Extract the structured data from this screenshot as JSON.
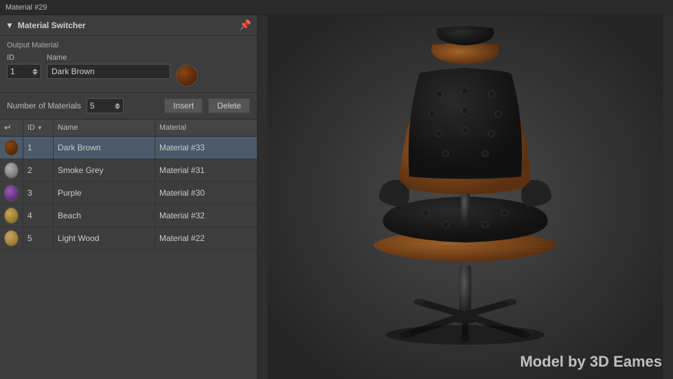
{
  "titleBar": {
    "label": "Material #29"
  },
  "panel": {
    "title": "Material Switcher",
    "pinIcon": "pin"
  },
  "outputSection": {
    "label": "Output Material",
    "idLabel": "ID",
    "idValue": "1",
    "nameLabel": "Name",
    "nameValue": "Dark Brown"
  },
  "countSection": {
    "label": "Number of Materials",
    "countValue": "5",
    "insertLabel": "Insert",
    "deleteLabel": "Delete"
  },
  "tableHeaders": {
    "swatchCol": "",
    "idCol": "ID",
    "nameCol": "Name",
    "materialCol": "Material"
  },
  "tableRows": [
    {
      "id": 1,
      "name": "Dark Brown",
      "material": "Material #33",
      "swatchClass": "swatch-darkbrown",
      "selected": true
    },
    {
      "id": 2,
      "name": "Smoke Grey",
      "material": "Material #31",
      "swatchClass": "swatch-smokegrey",
      "selected": false
    },
    {
      "id": 3,
      "name": "Purple",
      "material": "Material #30",
      "swatchClass": "swatch-purple",
      "selected": false
    },
    {
      "id": 4,
      "name": "Beach",
      "material": "Material #32",
      "swatchClass": "swatch-beach",
      "selected": false
    },
    {
      "id": 5,
      "name": "Light Wood",
      "material": "Material #22",
      "swatchClass": "swatch-lightwood",
      "selected": false
    }
  ],
  "watermark": "Model by 3D Eames"
}
